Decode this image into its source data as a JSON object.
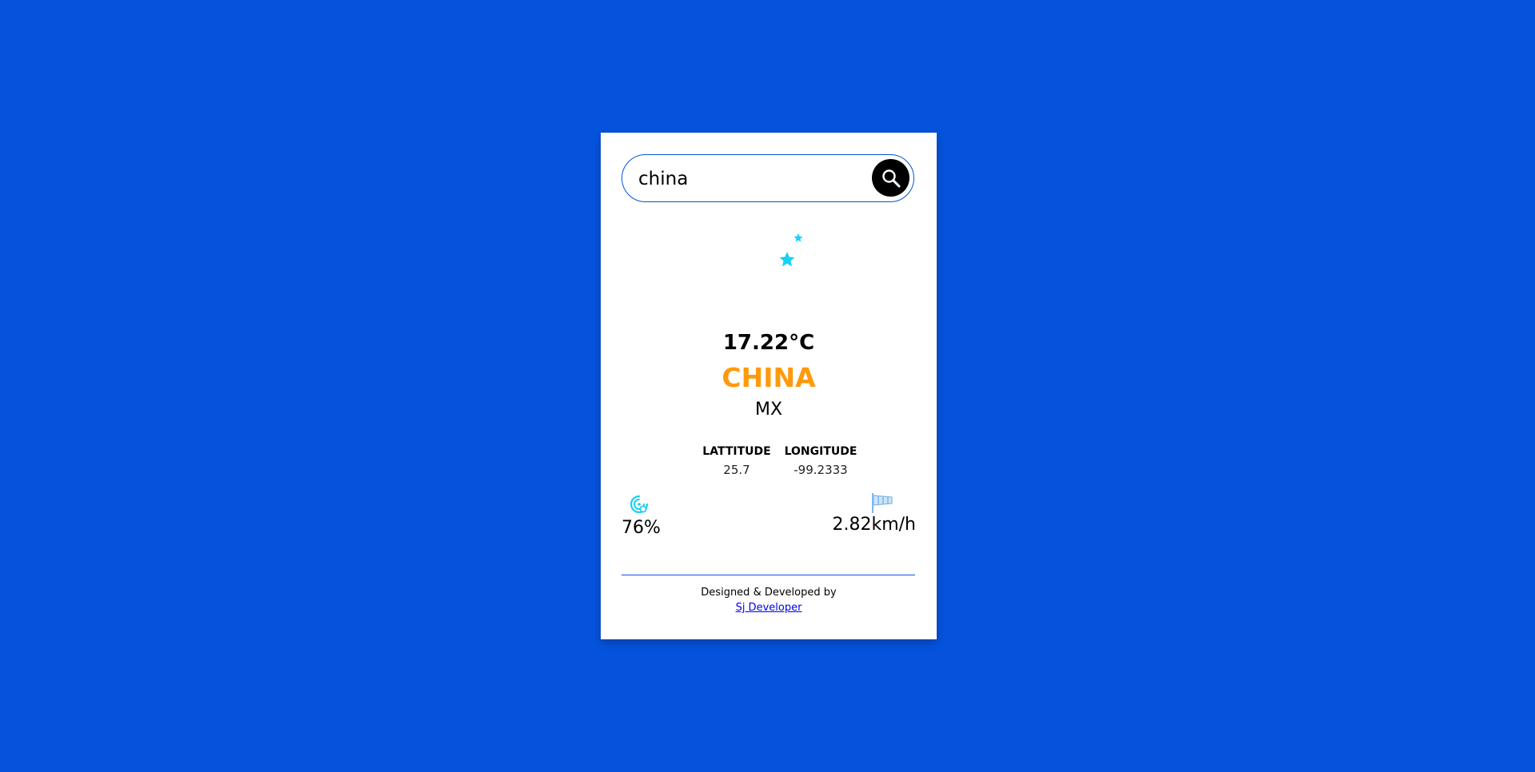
{
  "search": {
    "value": "china",
    "placeholder": ""
  },
  "weather": {
    "icon": "moon-stars-icon",
    "temperature": "17.22°C",
    "city": "CHINA",
    "country": "MX"
  },
  "coordinates": {
    "latitude_label": "LATTITUDE",
    "latitude_value": "25.7",
    "longitude_label": "LONGITUDE",
    "longitude_value": "-99.2333"
  },
  "stats": {
    "humidity_icon": "humidity-icon",
    "humidity": "76%",
    "wind_icon": "wind-sock-icon",
    "wind_speed": "2.82km/h"
  },
  "footer": {
    "credit": "Designed & Developed by",
    "link_text": "Sj Developer"
  },
  "colors": {
    "background": "#0553dd",
    "city": "#ff9a0c",
    "moon": "#ffcc00",
    "stars": "#19d1f0"
  }
}
